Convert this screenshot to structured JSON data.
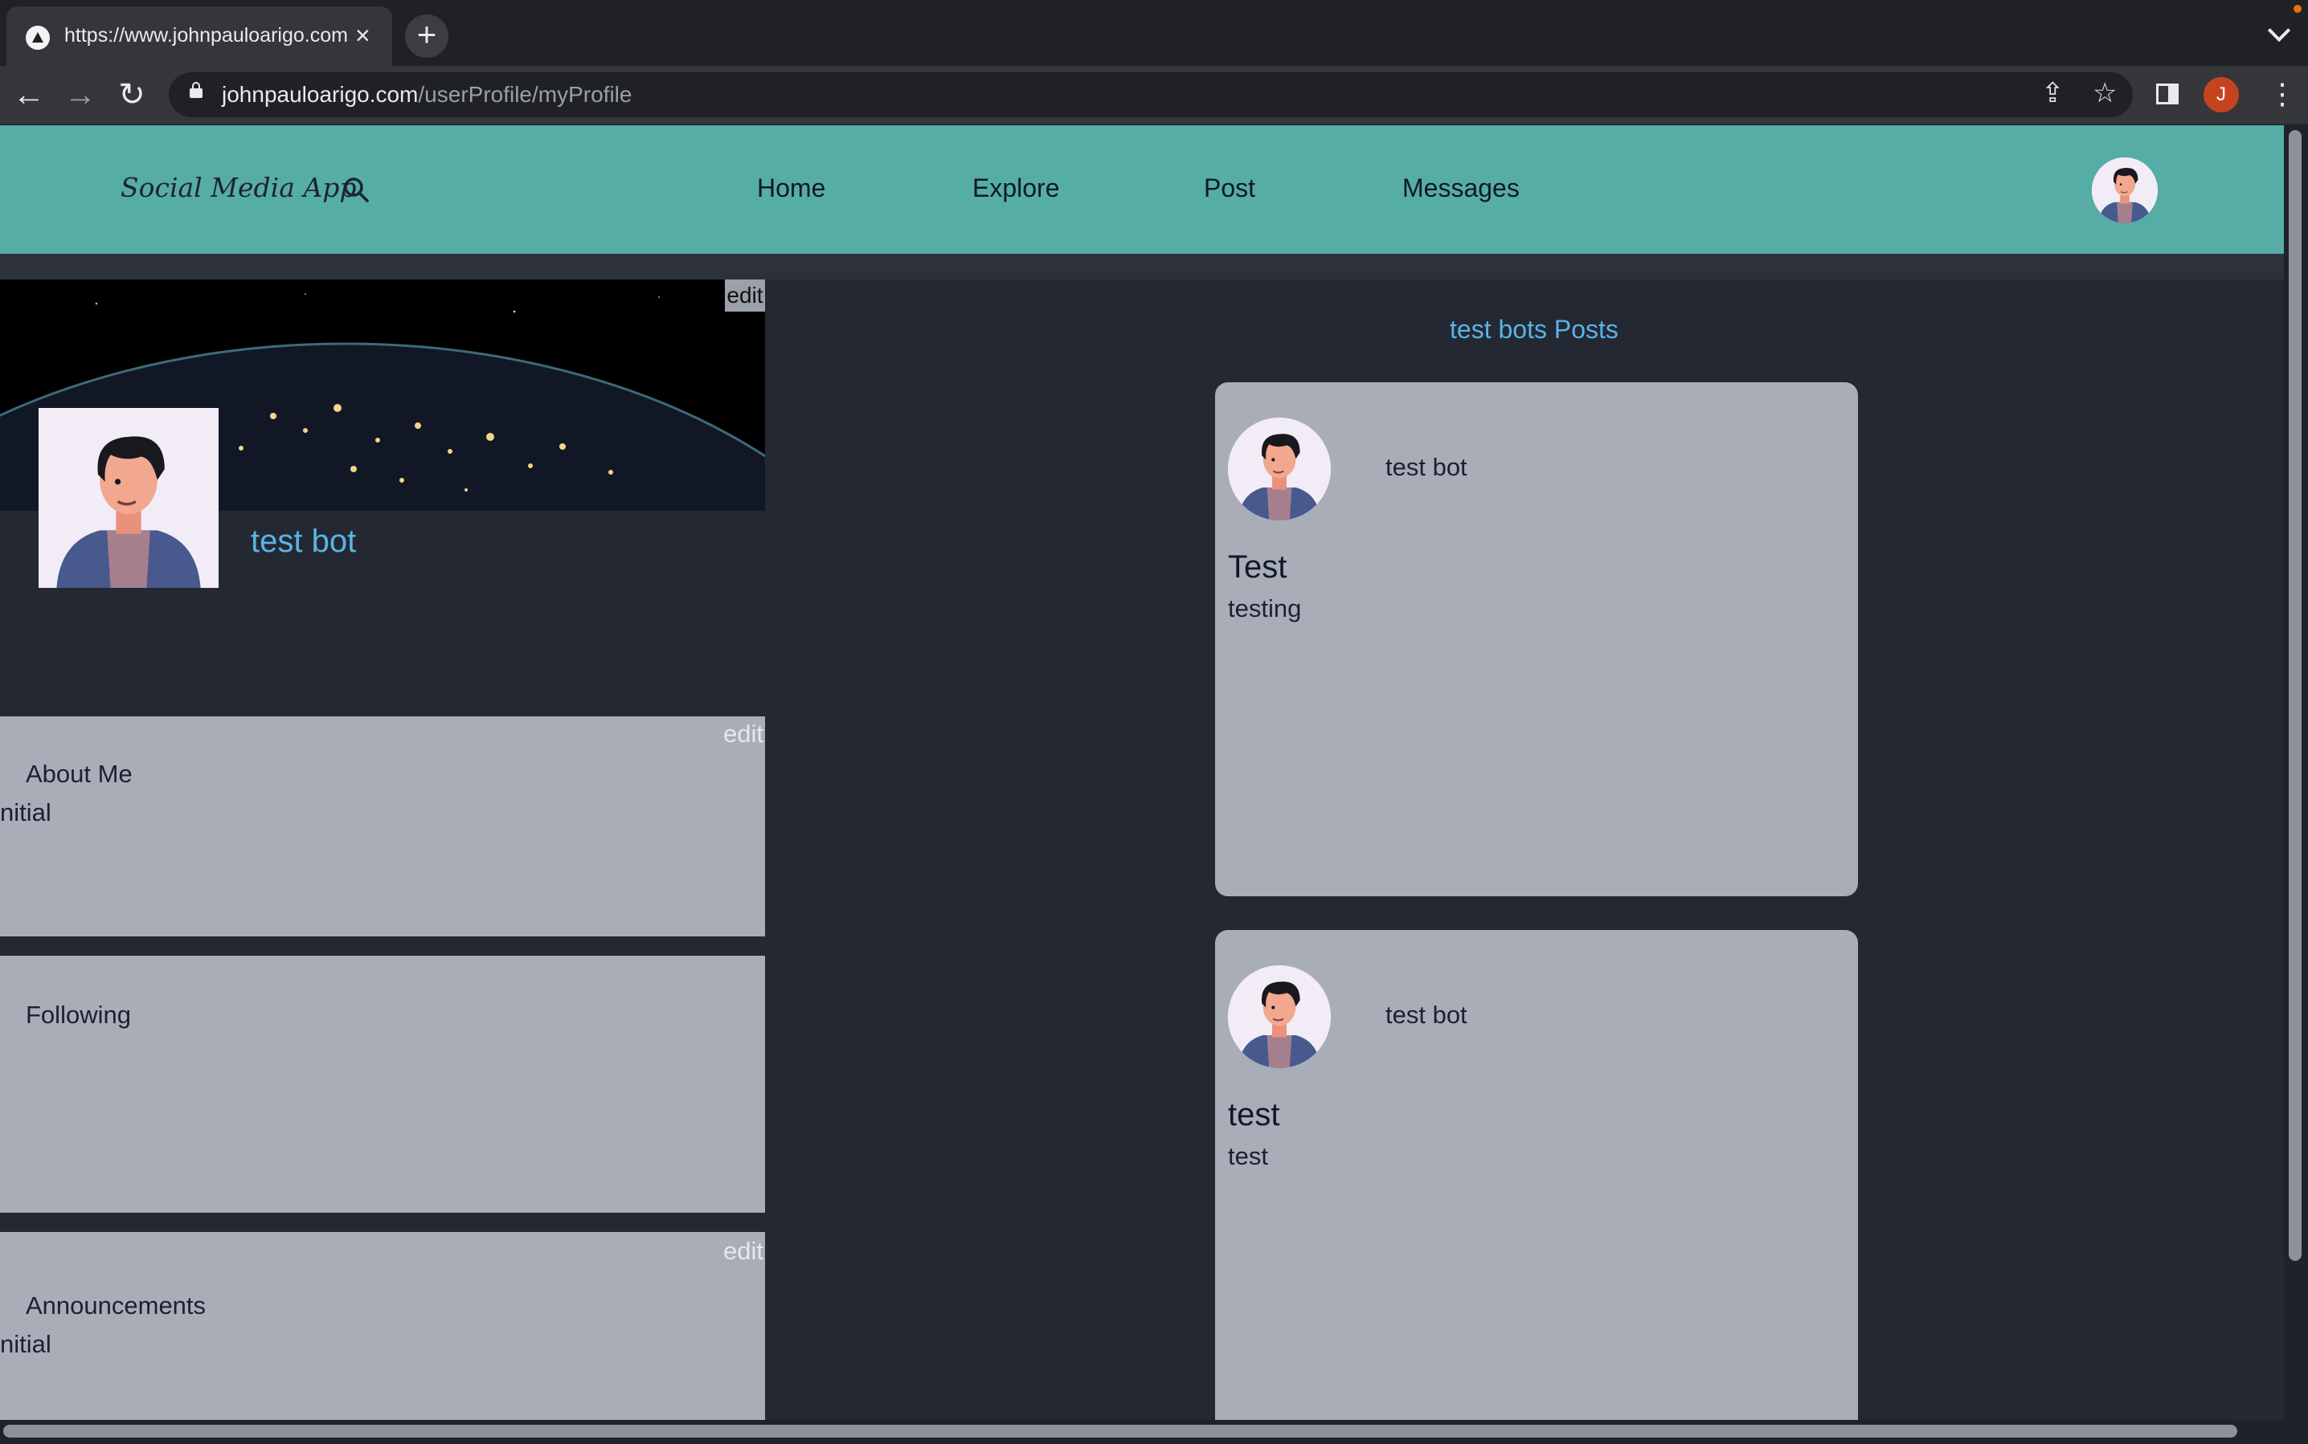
{
  "browser": {
    "tab_title": "https://www.johnpauloarigo.com",
    "tab_close": "×",
    "new_tab": "+",
    "url_domain": "johnpauloarigo.com",
    "url_path": "/userProfile/myProfile",
    "profile_initial": "J",
    "icons": [
      "back-arrow-icon",
      "forward-arrow-icon",
      "reload-icon",
      "lock-icon",
      "share-icon",
      "star-icon",
      "side-panel-icon",
      "kebab-menu-icon"
    ]
  },
  "nav": {
    "brand": "Social Media App",
    "links": [
      "Home",
      "Explore",
      "Post",
      "Messages"
    ],
    "color": "#55ada6"
  },
  "profile": {
    "edit_cover": "edit",
    "name": "test bot"
  },
  "about": {
    "title": "About Me",
    "body": "nitial",
    "edit": "edit"
  },
  "following": {
    "title": "Following"
  },
  "announcements": {
    "title": "Announcements",
    "body": "nitial",
    "edit": "edit"
  },
  "posts": {
    "heading": "test bots Posts",
    "items": [
      {
        "author": "test bot",
        "title": "Test",
        "body": "testing"
      },
      {
        "author": "test bot",
        "title": "test",
        "body": "test"
      }
    ]
  },
  "colors": {
    "page_bg": "#242833",
    "card_bg": "#a8adb8",
    "accent_text": "#57b5e6"
  }
}
